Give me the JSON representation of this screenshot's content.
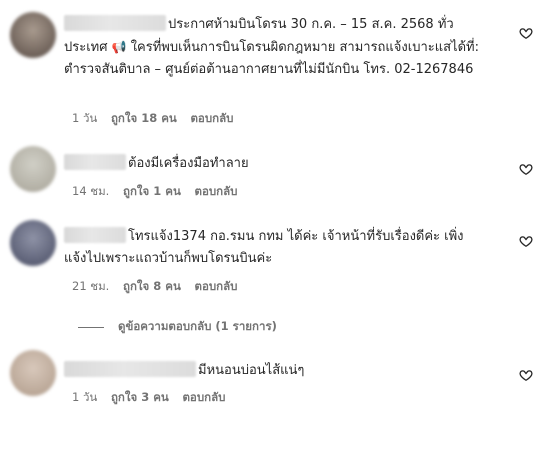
{
  "comments": [
    {
      "text_before_icon": "ประกาศห้ามบินโดรน 30 ก.ค. – 15 ส.ค. 2568 ทั่วประเทศ",
      "icon": "megaphone-icon",
      "text_after_icon": " ใครที่พบเห็นการบินโดรนผิดกฎหมาย สามารถแจ้งเบาะแสได้ที่: ตำรวจสันติบาล – ศูนย์ต่อต้านอากาศยานที่ไม่มีนักบิน โทร. 02-1267846",
      "time": "1 วัน",
      "likes": "ถูกใจ 18 คน",
      "reply": "ตอบกลับ"
    },
    {
      "text": "ต้องมีเครื่องมือทำลาย",
      "time": "14 ชม.",
      "likes": "ถูกใจ 1 คน",
      "reply": "ตอบกลับ"
    },
    {
      "text": "โทรแจ้ง1374 กอ.รมน กทม ได้ค่ะ เจ้าหน้าที่รับเรื่องดีค่ะ เพิ่งแจ้งไปเพราะแถวบ้านก็พบโดรนบินค่ะ",
      "time": "21 ชม.",
      "likes": "ถูกใจ 8 คน",
      "reply": "ตอบกลับ",
      "view_replies": "ดูข้อความตอบกลับ (1 รายการ)"
    },
    {
      "text": "มีหนอนบ่อนไส้แน่ๆ",
      "time": "1 วัน",
      "likes": "ถูกใจ 3 คน",
      "reply": "ตอบกลับ"
    }
  ]
}
